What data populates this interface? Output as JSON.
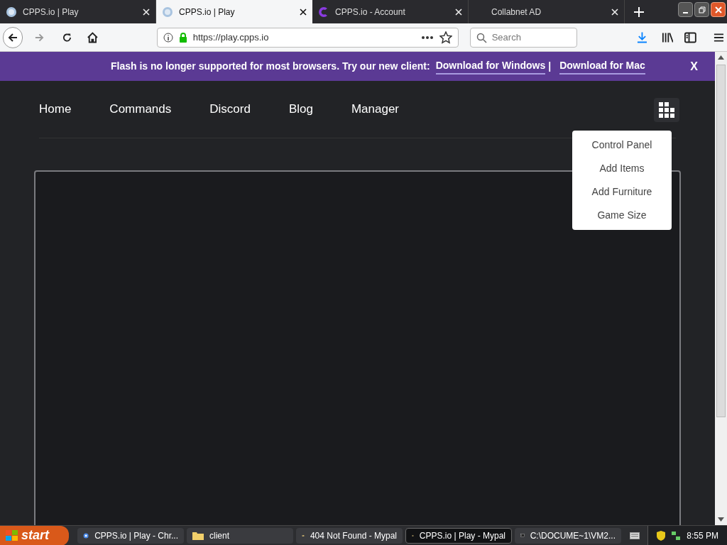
{
  "tabs": [
    {
      "title": "CPPS.io | Play",
      "selected": false,
      "kind": "globe"
    },
    {
      "title": "CPPS.io | Play",
      "selected": true,
      "kind": "globe"
    },
    {
      "title": "CPPS.io - Account",
      "selected": false,
      "kind": "logo"
    },
    {
      "title": "Collabnet AD",
      "selected": false,
      "kind": "none"
    }
  ],
  "address_bar": {
    "url": "https://play.cpps.io"
  },
  "search": {
    "placeholder": "Search"
  },
  "banner": {
    "message": "Flash is no longer supported for most browsers. Try our new client:",
    "links": [
      "Download for Windows",
      "Download for Mac"
    ],
    "separator": "|",
    "close": "X"
  },
  "nav": [
    "Home",
    "Commands",
    "Discord",
    "Blog",
    "Manager"
  ],
  "menu": [
    "Control Panel",
    "Add Items",
    "Add Furniture",
    "Game Size"
  ],
  "taskbar": {
    "start": "start",
    "items": [
      {
        "label": "CPPS.io | Play - Chr...",
        "selected": false,
        "kind": "browser"
      },
      {
        "label": "client",
        "selected": false,
        "kind": "folder"
      },
      {
        "label": "404 Not Found - Mypal",
        "selected": false,
        "kind": "app"
      },
      {
        "label": "CPPS.io | Play - Mypal",
        "selected": true,
        "kind": "app"
      },
      {
        "label": "C:\\DOCUME~1\\VM2...",
        "selected": false,
        "kind": "console"
      }
    ],
    "clock": "8:55 PM"
  }
}
